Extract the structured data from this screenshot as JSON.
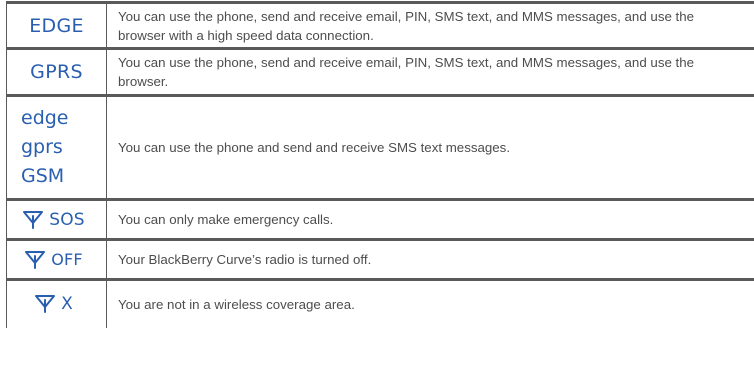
{
  "rows": [
    {
      "indicator": "EDGE",
      "description": "You can use the phone, send and receive email, PIN, SMS text, and MMS messages, and use the browser with a high speed data connection."
    },
    {
      "indicator": "GPRS",
      "description": "You can use the phone, send and receive email, PIN, SMS text, and MMS messages, and use the browser."
    },
    {
      "indicator_lines": [
        "edge",
        "gprs",
        "GSM"
      ],
      "description": "You can use the phone and send and receive SMS text messages."
    },
    {
      "indicator_icon": "antenna-signal-icon",
      "indicator": "SOS",
      "description": "You can only make emergency calls."
    },
    {
      "indicator_icon": "antenna-signal-icon",
      "indicator": "OFF",
      "description": "Your BlackBerry Curve’s radio is turned off."
    },
    {
      "indicator_icon": "antenna-signal-icon",
      "indicator": "X",
      "description": "You are not in a wireless coverage area."
    }
  ],
  "colors": {
    "indicator": "#2a5fb0",
    "text": "#4d4d4d",
    "border": "#5a5a5a"
  }
}
